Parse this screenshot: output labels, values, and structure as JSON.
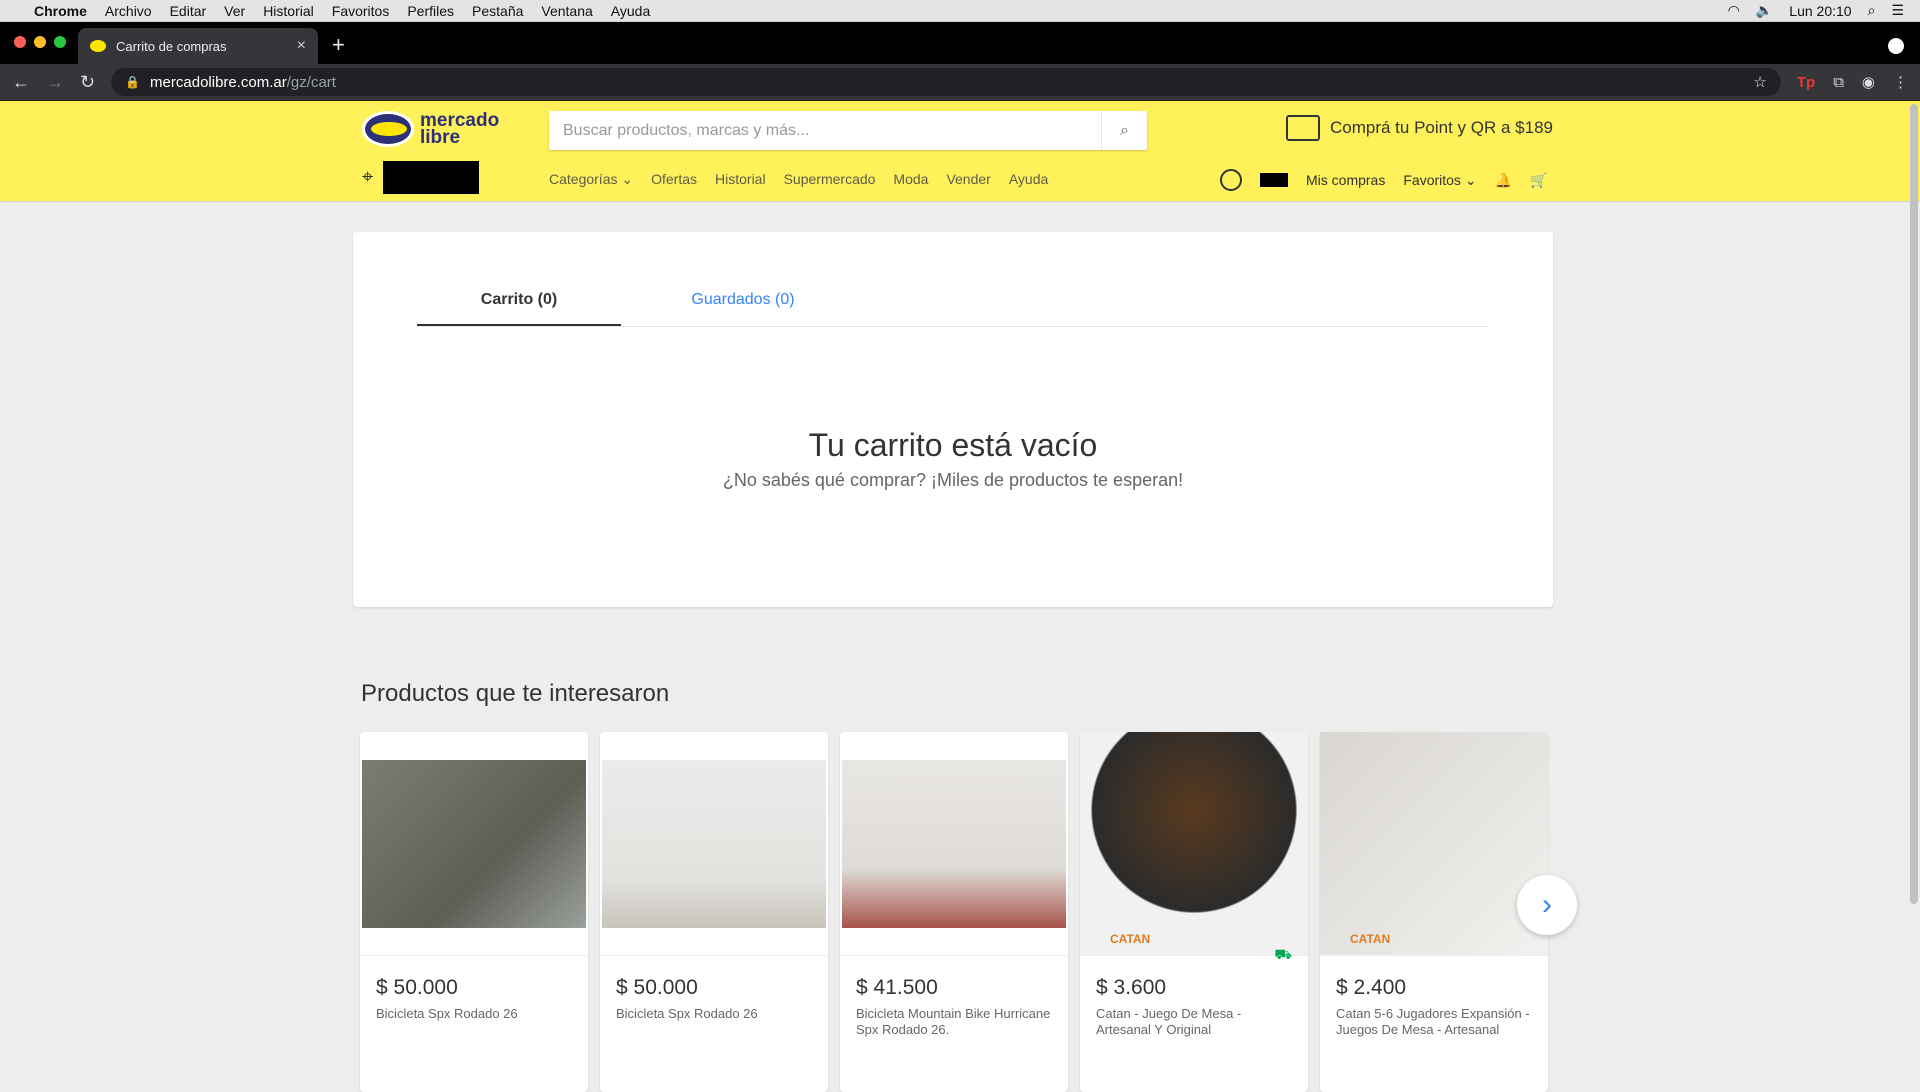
{
  "macos": {
    "app": "Chrome",
    "menus": [
      "Archivo",
      "Editar",
      "Ver",
      "Historial",
      "Favoritos",
      "Perfiles",
      "Pestaña",
      "Ventana",
      "Ayuda"
    ],
    "clock": "Lun 20:10"
  },
  "browser": {
    "tab_title": "Carrito de compras",
    "url_host": "mercadolibre.com.ar",
    "url_path": "/gz/cart"
  },
  "header": {
    "logo_line1": "mercado",
    "logo_line2": "libre",
    "search_placeholder": "Buscar productos, marcas y más...",
    "promo": "Comprá tu Point y QR a $189",
    "nav": [
      "Categorías ⌄",
      "Ofertas",
      "Historial",
      "Supermercado",
      "Moda",
      "Vender",
      "Ayuda"
    ],
    "mis_compras": "Mis compras",
    "favoritos": "Favoritos ⌄"
  },
  "cart": {
    "tab_cart": "Carrito (0)",
    "tab_saved": "Guardados (0)",
    "empty_title": "Tu carrito está vacío",
    "empty_sub": "¿No sabés qué comprar? ¡Miles de productos te esperan!"
  },
  "recommendations": {
    "title": "Productos que te interesaron",
    "items": [
      {
        "price": "$ 50.000",
        "title": "Bicicleta Spx Rodado 26"
      },
      {
        "price": "$ 50.000",
        "title": "Bicicleta Spx Rodado 26"
      },
      {
        "price": "$ 41.500",
        "title": "Bicicleta Mountain Bike Hurricane Spx Rodado 26."
      },
      {
        "price": "$ 3.600",
        "title": "Catan - Juego De Mesa - Artesanal Y Original",
        "label": "CATAN"
      },
      {
        "price": "$ 2.400",
        "title": "Catan 5-6 Jugadores Expansión - Juegos De Mesa - Artesanal",
        "label": "CATAN"
      }
    ]
  }
}
